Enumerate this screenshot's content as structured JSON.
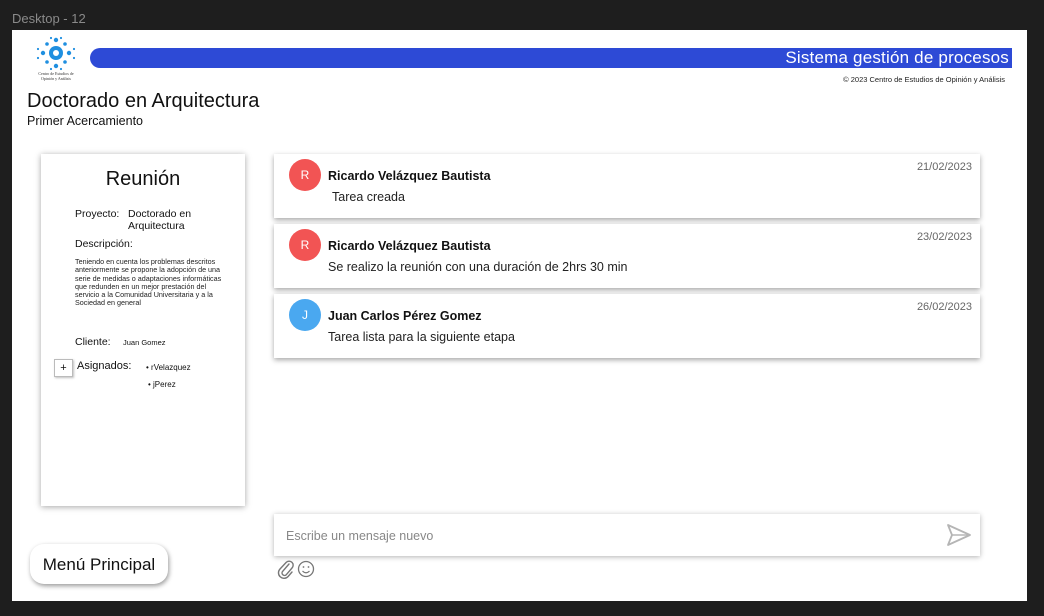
{
  "frame_label": "Desktop - 12",
  "logo": {
    "text": "Centro de Estudios de Opinión y Análisis"
  },
  "header": {
    "system_title": "Sistema gestión de procesos",
    "copyright": "© 2023 Centro de Estudios de Opinión y Análisis",
    "brand_color": "#2d4ad6"
  },
  "page": {
    "title": "Doctorado en Arquitectura",
    "subtitle": "Primer Acercamiento"
  },
  "task_card": {
    "title": "Reunión",
    "project_label": "Proyecto:",
    "project_value": "Doctorado en Arquitectura",
    "description_label": "Descripción:",
    "description_text": "Teniendo en cuenta los problemas descritos anteriormente se propone la adopción de una serie de medidas o adaptaciones informáticas que redunden en un mejor prestación del servicio a la Comunidad Universitaria y a la Sociedad en general",
    "client_label": "Cliente:",
    "client_value": "Juan Gomez",
    "add_label": "+",
    "assigned_label": "Asignados:",
    "assigned": [
      "rVelazquez",
      "jPerez"
    ]
  },
  "messages": [
    {
      "initial": "R",
      "author": "Ricardo Velázquez Bautista",
      "text": "Tarea creada",
      "date": "21/02/2023",
      "avatar_color": "#f25454"
    },
    {
      "initial": "R",
      "author": "Ricardo Velázquez Bautista",
      "text": "Se realizo la reunión con una duración de 2hrs 30 min",
      "date": "23/02/2023",
      "avatar_color": "#f25454"
    },
    {
      "initial": "J",
      "author": "Juan Carlos Pérez Gomez",
      "text": "Tarea lista para la siguiente etapa",
      "date": "26/02/2023",
      "avatar_color": "#4aa8f0"
    }
  ],
  "composer": {
    "placeholder": "Escribe un mensaje nuevo",
    "send_icon": "send-icon",
    "attach_icon": "paperclip-icon",
    "emoji_icon": "smiley-icon"
  },
  "main_menu_label": "Menú Principal"
}
